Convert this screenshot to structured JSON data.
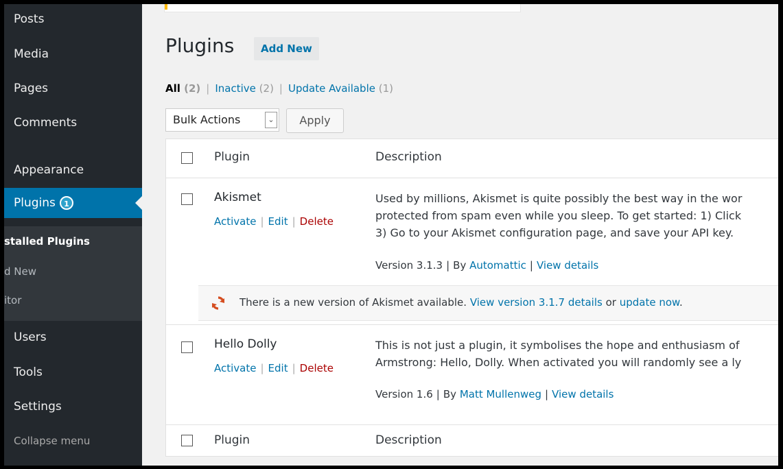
{
  "sidebar": {
    "items": [
      {
        "label": "Posts"
      },
      {
        "label": "Media"
      },
      {
        "label": "Pages"
      },
      {
        "label": "Comments"
      },
      {
        "label": "Appearance"
      },
      {
        "label": "Plugins",
        "badge": "1"
      },
      {
        "label": "Users"
      },
      {
        "label": "Tools"
      },
      {
        "label": "Settings"
      }
    ],
    "submenu": [
      {
        "label": "stalled Plugins"
      },
      {
        "label": "d New"
      },
      {
        "label": "itor"
      }
    ],
    "collapse_label": "Collapse menu"
  },
  "page": {
    "title": "Plugins",
    "add_new_label": "Add New"
  },
  "filters": {
    "all_label": "All",
    "all_count": "(2)",
    "inactive_label": "Inactive",
    "inactive_count": "(2)",
    "update_label": "Update Available",
    "update_count": "(1)",
    "separator": "|"
  },
  "bulk": {
    "selected": "Bulk Actions",
    "apply_label": "Apply"
  },
  "table": {
    "col_plugin": "Plugin",
    "col_description": "Description",
    "plugins": [
      {
        "name": "Akismet",
        "activate": "Activate",
        "edit": "Edit",
        "delete": "Delete",
        "desc_lines": [
          "Used by millions, Akismet is quite possibly the best way in the wor",
          "protected from spam even while you sleep. To get started: 1) Click",
          "3) Go to your Akismet configuration page, and save your API key."
        ],
        "version": "Version 3.1.3",
        "by_label": "By",
        "author": "Automattic",
        "view_details": "View details"
      },
      {
        "name": "Hello Dolly",
        "activate": "Activate",
        "edit": "Edit",
        "delete": "Delete",
        "desc_lines": [
          "This is not just a plugin, it symbolises the hope and enthusiasm of",
          "Armstrong: Hello, Dolly. When activated you will randomly see a ly"
        ],
        "version": "Version 1.6",
        "by_label": "By",
        "author": "Matt Mullenweg",
        "view_details": "View details"
      }
    ],
    "update_notice": {
      "prefix": "There is a new version of Akismet available.",
      "view_link": "View version 3.1.7 details",
      "middle": "or",
      "update_link": "update now",
      "suffix": "."
    }
  },
  "colors": {
    "sidebar_bg": "#23282d",
    "active_bg": "#0073aa",
    "link": "#0073aa",
    "delete": "#a00",
    "update_icon": "#d54e21"
  },
  "icons": {
    "update": "update-icon",
    "arrow": "active-arrow"
  }
}
